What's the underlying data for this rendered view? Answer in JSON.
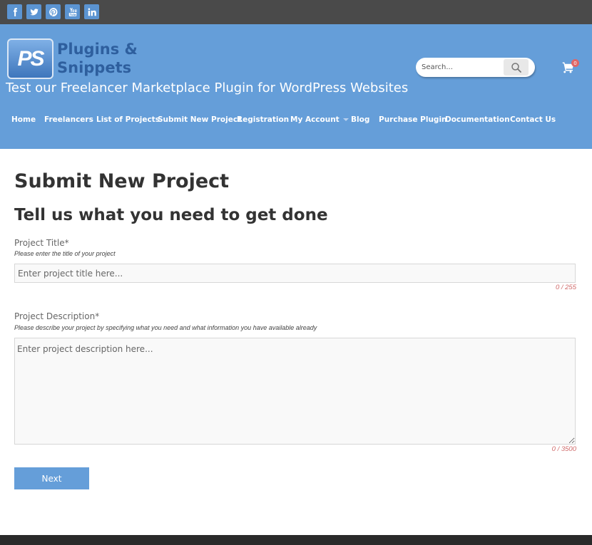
{
  "social": [
    {
      "name": "facebook-icon"
    },
    {
      "name": "twitter-icon"
    },
    {
      "name": "pinterest-icon"
    },
    {
      "name": "youtube-icon"
    },
    {
      "name": "linkedin-icon"
    }
  ],
  "header": {
    "logo_mark": "PS",
    "logo_line1": "Plugins &",
    "logo_line2": "Snippets",
    "tagline": "Test our Freelancer Marketplace Plugin for WordPress Websites",
    "search_placeholder": "Search...",
    "cart_count": "0"
  },
  "nav": {
    "items": [
      {
        "label": "Home"
      },
      {
        "label": "Freelancers"
      },
      {
        "label": "List of Projects"
      },
      {
        "label": "Submit New Project"
      },
      {
        "label": "Registration"
      },
      {
        "label": "My Account"
      },
      {
        "label": "Blog"
      },
      {
        "label": "Purchase Plugin"
      },
      {
        "label": "Documentation"
      },
      {
        "label": "Contact Us"
      }
    ]
  },
  "form": {
    "page_title": "Submit New Project",
    "subtitle": "Tell us what you need to get done",
    "title_label": "Project Title*",
    "title_hint": "Please enter the title of your project",
    "title_placeholder": "Enter project title here...",
    "title_counter": "0 / 255",
    "desc_label": "Project Description*",
    "desc_hint": "Please describe your project by specifying what you need and what information you have available already",
    "desc_placeholder": "Enter project description here...",
    "desc_counter": "0 / 3500",
    "next_label": "Next"
  },
  "colors": {
    "brand_blue": "#659ed9",
    "topbar": "#4a4a4a",
    "footer": "#2a2a2a",
    "counter": "#d06a6a"
  }
}
